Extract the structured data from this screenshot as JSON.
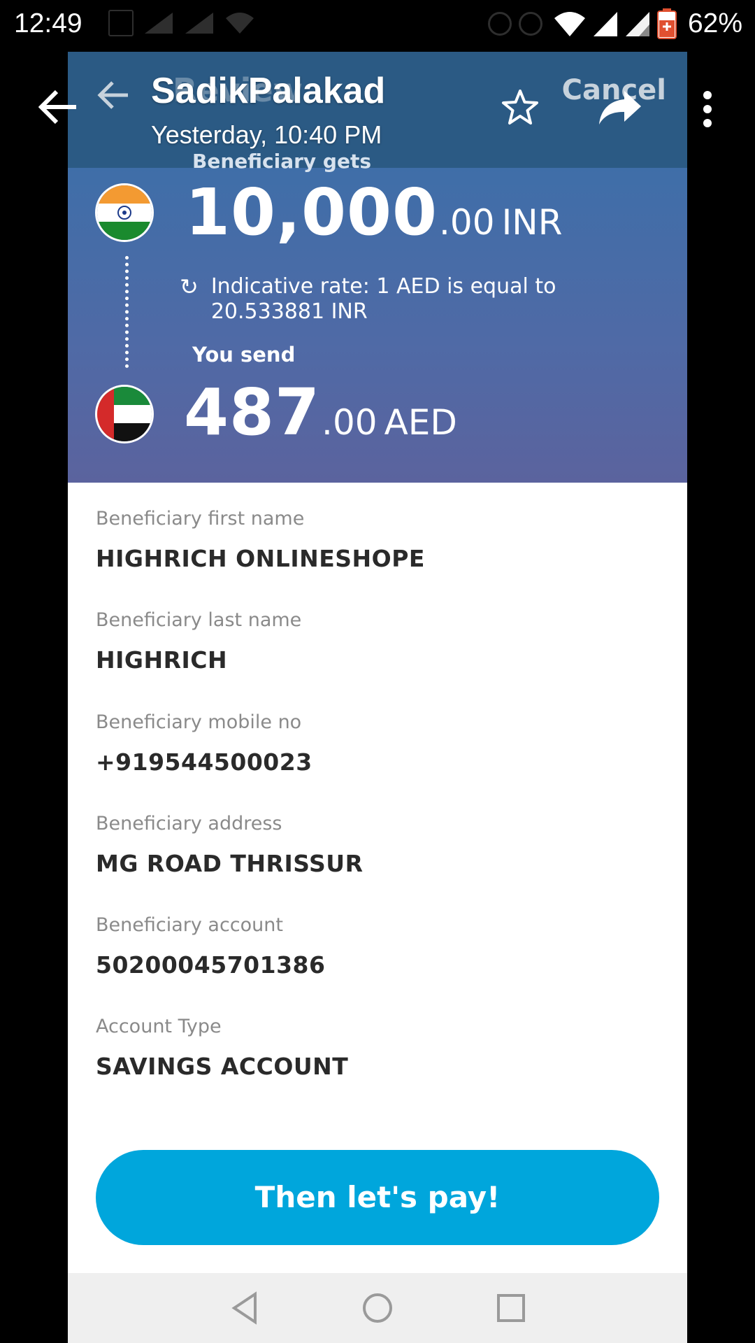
{
  "status_bar": {
    "time": "12:49",
    "battery_pct": "62%",
    "icons": [
      "wifi-icon",
      "signal-icon",
      "signal-icon",
      "battery-icon"
    ]
  },
  "viewer": {
    "sender": "SadikPalakad",
    "timestamp": "Yesterday, 10:40 PM",
    "icons": [
      "back-arrow-icon",
      "star-icon",
      "share-icon",
      "more-vert-icon"
    ]
  },
  "app": {
    "header": {
      "cancel_label": "Cancel",
      "ghost_title": "Review"
    },
    "transfer": {
      "gets_label": "Beneficiary gets",
      "gets_amount_int": "10,000",
      "gets_amount_dec": ".00",
      "gets_currency": "INR",
      "rate_text": "Indicative rate: 1 AED is equal to 20.533881 INR",
      "send_label": "You send",
      "send_amount_int": "487",
      "send_amount_dec": ".00",
      "send_currency": "AED"
    },
    "fields": [
      {
        "label": "Beneficiary first name",
        "value": "HIGHRICH ONLINESHOPE"
      },
      {
        "label": "Beneficiary last name",
        "value": "HIGHRICH"
      },
      {
        "label": "Beneficiary mobile no",
        "value": "+919544500023"
      },
      {
        "label": "Beneficiary address",
        "value": "MG ROAD THRISSUR"
      },
      {
        "label": "Beneficiary account",
        "value": "50200045701386"
      },
      {
        "label": "Account Type",
        "value": "SAVINGS ACCOUNT"
      }
    ],
    "pay_button_label": "Then let's pay!"
  },
  "colors": {
    "header_bg": "#2b5a84",
    "panel_top": "#3f6ea8",
    "panel_bottom": "#5b639e",
    "pay_button": "#00a6dc"
  }
}
